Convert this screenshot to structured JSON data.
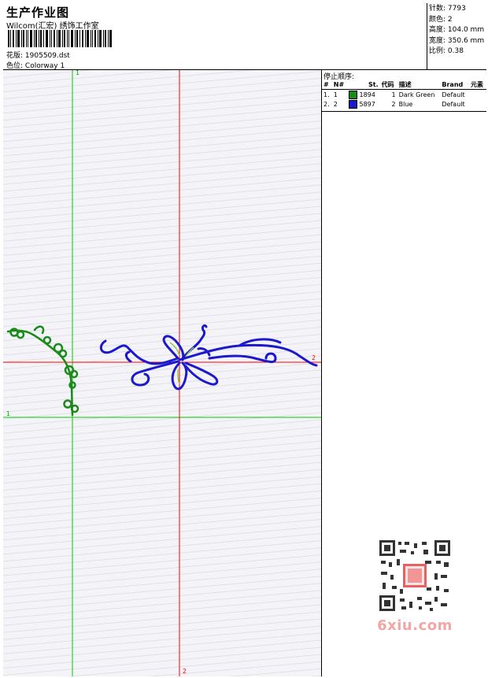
{
  "header": {
    "title": "生产作业图",
    "studio": "Wilcom(汇宏) 绣饰工作室",
    "design_label": "花版:",
    "design_value": "1905509.dst",
    "colorway_label": "色位:",
    "colorway_value": "Colorway 1"
  },
  "stats": [
    {
      "label": "针数:",
      "value": "7793"
    },
    {
      "label": "颜色:",
      "value": "2"
    },
    {
      "label": "高度:",
      "value": "104.0 mm"
    },
    {
      "label": "宽度:",
      "value": "350.6 mm"
    },
    {
      "label": "比例:",
      "value": "0.38"
    }
  ],
  "stop_sequence": {
    "title": "停止顺序:",
    "columns": [
      "#",
      "N#",
      "St.",
      "代码",
      "描述",
      "Brand",
      "元素"
    ],
    "rows": [
      {
        "index": "1.",
        "n": "1",
        "color": "#1a8a1a",
        "stitches": "1894",
        "code": "1",
        "description": "Dark Green",
        "brand": "Default"
      },
      {
        "index": "2.",
        "n": "2",
        "color": "#1a1acc",
        "stitches": "5897",
        "code": "2",
        "description": "Blue",
        "brand": "Default"
      }
    ]
  },
  "guides": {
    "green_vertical_label": "1",
    "green_horizontal_label": "1",
    "red_vertical_label": "2",
    "red_horizontal_label": "2"
  },
  "colors": {
    "guide_green": "#00cc00",
    "guide_red": "#ff0000",
    "thread_green": "#1a8a1a",
    "thread_blue": "#1a1acc"
  },
  "watermark": "6xiu.com"
}
